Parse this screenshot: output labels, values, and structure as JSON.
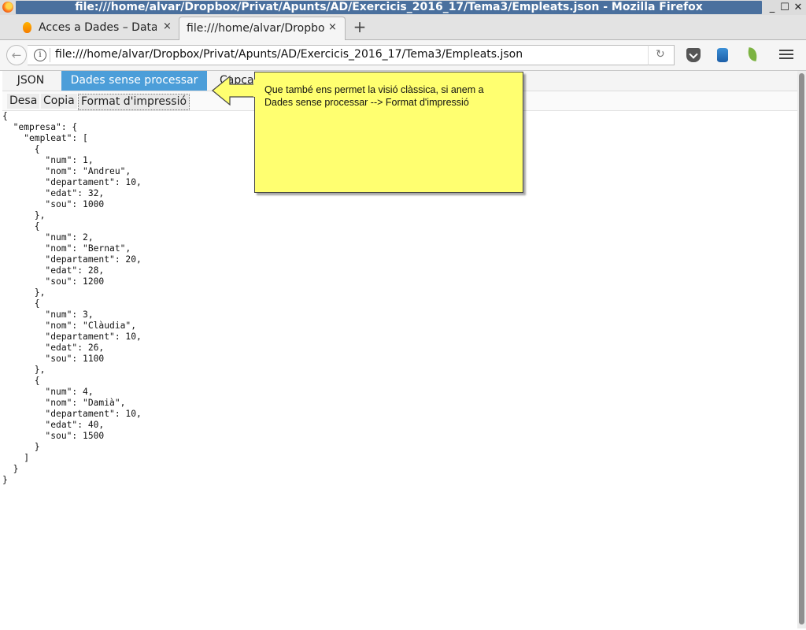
{
  "window": {
    "title": "file:///home/alvar/Dropbox/Privat/Apunts/AD/Exercicis_2016_17/Tema3/Empleats.json - Mozilla Firefox",
    "minimize": "_",
    "maximize": "☐",
    "close": "✕"
  },
  "tabs": [
    {
      "label": "Acces a Dades – Database",
      "close": "×"
    },
    {
      "label": "file:///home/alvar/Dropbox",
      "close": "×"
    }
  ],
  "new_tab": "+",
  "nav": {
    "back": "←",
    "url": "file:///home/alvar/Dropbox/Privat/Apunts/AD/Exercicis_2016_17/Tema3/Empleats.json",
    "reload": "↻"
  },
  "viewer": {
    "tabs": [
      "JSON",
      "Dades sense processar",
      "Capçaleres"
    ],
    "active_tab": "Dades sense processar",
    "toolbar": {
      "save": "Desa",
      "copy": "Copia",
      "pretty_print": "Format d'impressió"
    },
    "raw_text": "{\n  \"empresa\": {\n    \"empleat\": [\n      {\n        \"num\": 1,\n        \"nom\": \"Andreu\",\n        \"departament\": 10,\n        \"edat\": 32,\n        \"sou\": 1000\n      },\n      {\n        \"num\": 2,\n        \"nom\": \"Bernat\",\n        \"departament\": 20,\n        \"edat\": 28,\n        \"sou\": 1200\n      },\n      {\n        \"num\": 3,\n        \"nom\": \"Clàudia\",\n        \"departament\": 10,\n        \"edat\": 26,\n        \"sou\": 1100\n      },\n      {\n        \"num\": 4,\n        \"nom\": \"Damià\",\n        \"departament\": 10,\n        \"edat\": 40,\n        \"sou\": 1500\n      }\n    ]\n  }\n}"
  },
  "callout": {
    "text": "Que també ens permet la visió clàssica, si anem a Dades sense processar --> Format d'impressió"
  },
  "colors": {
    "title_bar": "#4a709e",
    "active_viewer_tab": "#4c9ed9",
    "callout_bg": "#ffff70"
  }
}
